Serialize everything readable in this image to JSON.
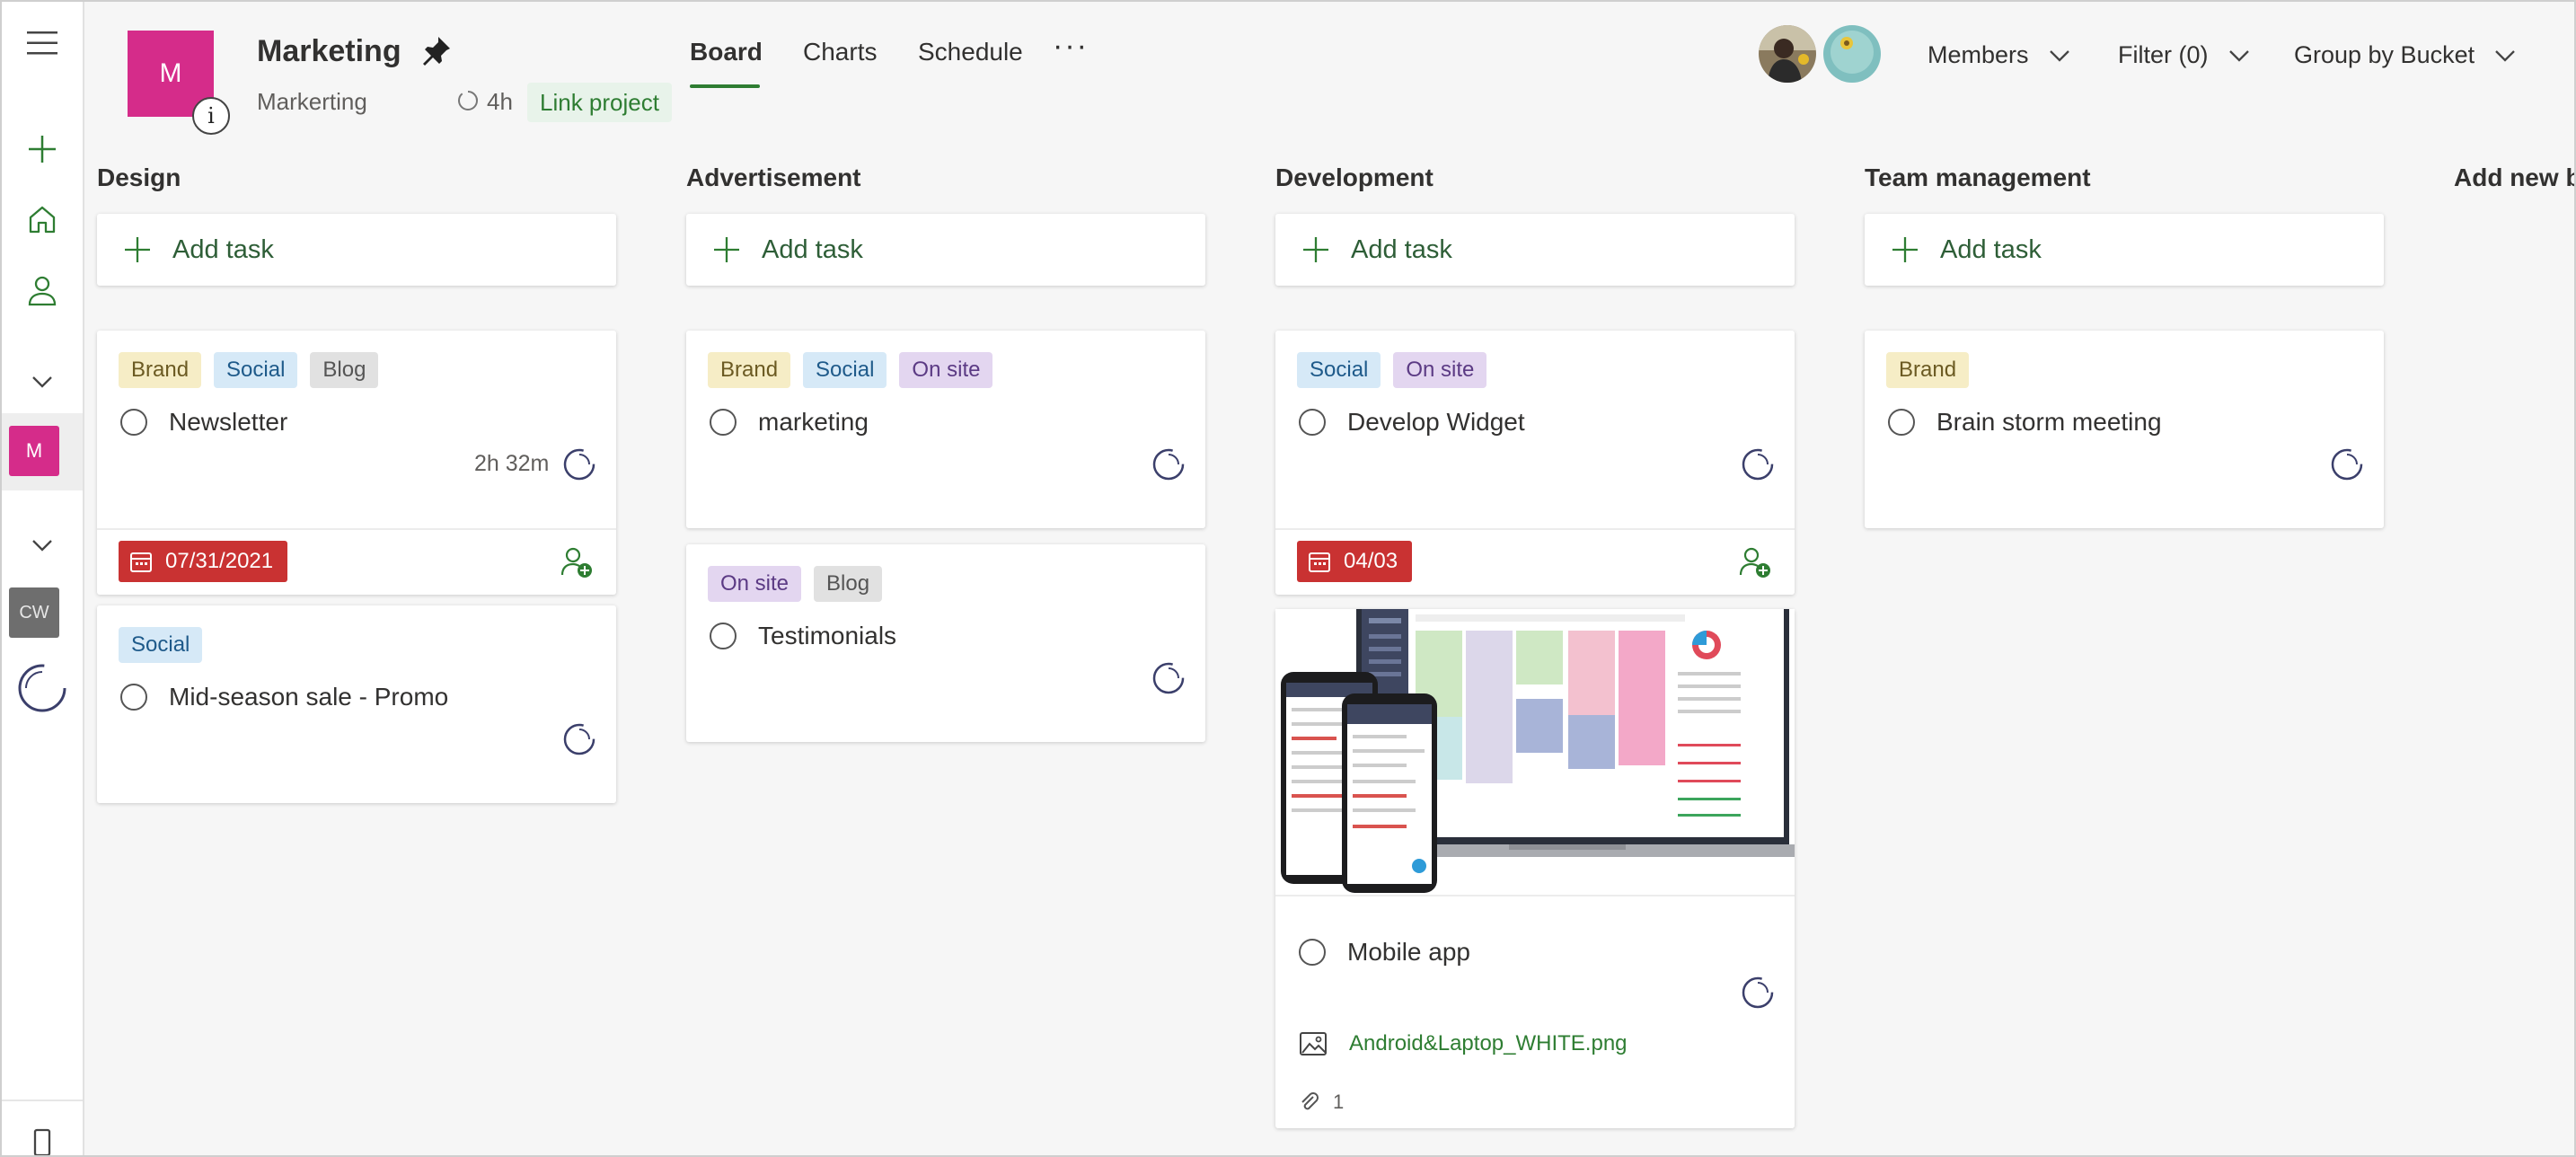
{
  "project": {
    "logo_letter": "M",
    "title": "Marketing",
    "subtitle": "Markerting",
    "hours": "4h",
    "link_label": "Link project",
    "info_glyph": "i"
  },
  "tabs": [
    {
      "label": "Board",
      "active": true
    },
    {
      "label": "Charts",
      "active": false
    },
    {
      "label": "Schedule",
      "active": false
    }
  ],
  "more_glyph": "···",
  "controls": {
    "members": "Members",
    "filter": "Filter (0)",
    "group_by": "Group by Bucket"
  },
  "rail": {
    "project_m": "M",
    "project_cw": "CW"
  },
  "buckets": [
    {
      "title": "Design"
    },
    {
      "title": "Advertisement"
    },
    {
      "title": "Development"
    },
    {
      "title": "Team management"
    },
    {
      "title": "Add new bucket"
    }
  ],
  "add_task_label": "Add task",
  "labels": {
    "brand": "Brand",
    "social": "Social",
    "blog": "Blog",
    "on_site": "On site"
  },
  "tasks": {
    "newsletter": {
      "title": "Newsletter",
      "time_estimate": "2h 32m",
      "due": "07/31/2021"
    },
    "mid_season": {
      "title": "Mid-season sale - Promo"
    },
    "marketing": {
      "title": "marketing"
    },
    "testimonials": {
      "title": "Testimonials"
    },
    "develop_widget": {
      "title": "Develop Widget",
      "due": "04/03"
    },
    "mobile_app": {
      "title": "Mobile app",
      "attachment": "Android&Laptop_WHITE.png",
      "attachment_count": "1"
    },
    "brain_storm": {
      "title": "Brain storm meeting"
    }
  },
  "colors": {
    "accent_green": "#2e7d32",
    "project_magenta": "#d52c8a",
    "due_red": "#c93232"
  }
}
